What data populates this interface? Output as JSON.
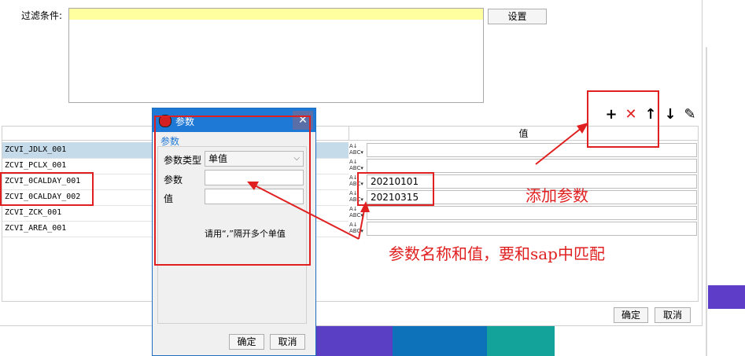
{
  "main_window": {
    "filter_label": "过滤条件:",
    "settings_button": "设置",
    "value_column_header": "值",
    "rows": [
      {
        "name": "ZCVI_JDLX_001",
        "value": ""
      },
      {
        "name": "ZCVI_PCLX_001",
        "value": ""
      },
      {
        "name": "ZCVI_0CALDAY_001",
        "value": "20210101"
      },
      {
        "name": "ZCVI_0CALDAY_002",
        "value": "20210315"
      },
      {
        "name": "ZCVI_ZCK_001",
        "value": ""
      },
      {
        "name": "ZCVI_AREA_001",
        "value": ""
      }
    ],
    "toolbar": {
      "add": "+",
      "delete": "✕",
      "up": "↑",
      "down": "↓",
      "edit": "✎"
    },
    "ok_button": "确定",
    "cancel_button": "取消"
  },
  "dialog": {
    "title": "参数",
    "close": "✕",
    "section_label": "参数",
    "param_type_label": "参数类型",
    "param_type_value": "单值",
    "param_label": "参数",
    "param_value": "",
    "value_label": "值",
    "value_value": "",
    "hint": "请用“,”隔开多个单值",
    "ok_button": "确定",
    "cancel_button": "取消"
  },
  "annotations": {
    "add_param": "添加参数",
    "match_note": "参数名称和值，要和sap中匹配"
  },
  "colors": {
    "annotation": "#e02020",
    "title_bar": "#1e78d6",
    "selected_row": "#c5dbe9",
    "filter_highlight": "#ffffa0"
  }
}
